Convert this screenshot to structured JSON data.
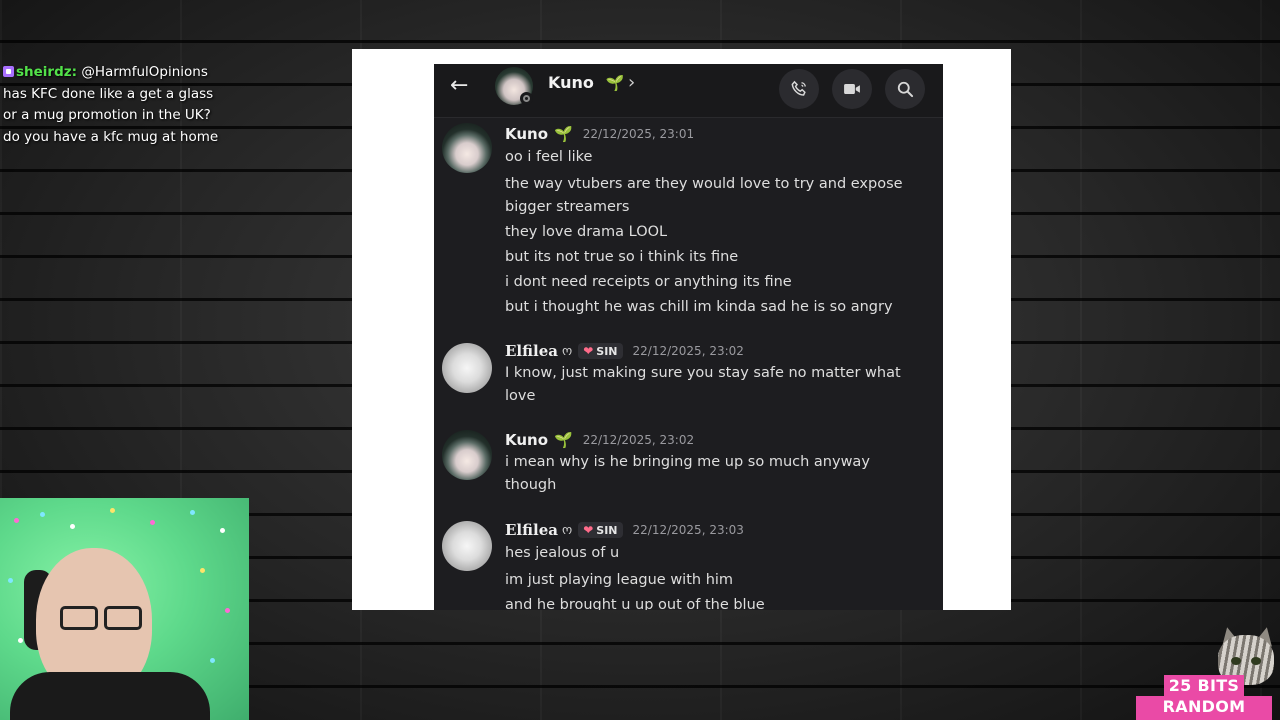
{
  "chat_overlay": {
    "username": "sheirdz",
    "message": "@HarmfulOpinions has KFC done like a get a glass or a mug promotion in the UK? do you have a kfc mug at home",
    "colors": {
      "username": "#53e34a",
      "badge": "#a970ff"
    }
  },
  "phone": {
    "header": {
      "title": "Kuno",
      "title_emoji": "🌱",
      "icons": [
        "back-arrow-icon",
        "chevron-right-icon",
        "voice-call-icon",
        "video-call-icon",
        "search-icon"
      ]
    },
    "messages": [
      {
        "author": "Kuno",
        "author_emoji": "🌱",
        "timestamp": "22/12/2025, 23:01",
        "lines": [
          "oo i feel like",
          "the way vtubers are they would love to try and expose",
          "bigger streamers",
          "they love drama LOOL",
          "but its not true so i think its fine",
          "i dont need receipts or anything its fine",
          "but i thought he was chill im kinda sad he is so angry"
        ]
      },
      {
        "author": "Elfilea",
        "author_suffix": "ო",
        "badge": "SIN",
        "timestamp": "22/12/2025, 23:02",
        "lines": [
          "I know, just making sure you stay safe no matter what",
          "love"
        ]
      },
      {
        "author": "Kuno",
        "author_emoji": "🌱",
        "timestamp": "22/12/2025, 23:02",
        "lines": [
          "i mean why is he bringing me up so much anyway",
          "though"
        ]
      },
      {
        "author": "Elfilea",
        "author_suffix": "ო",
        "badge": "SIN",
        "timestamp": "22/12/2025, 23:03",
        "lines": [
          "hes jealous of u",
          "im just playing league with him",
          "and he brought u up out of the blue"
        ]
      }
    ]
  },
  "alert": {
    "line1": "25 BITS",
    "line2": "RANDOM SORB",
    "color": "#ea4aa6"
  }
}
